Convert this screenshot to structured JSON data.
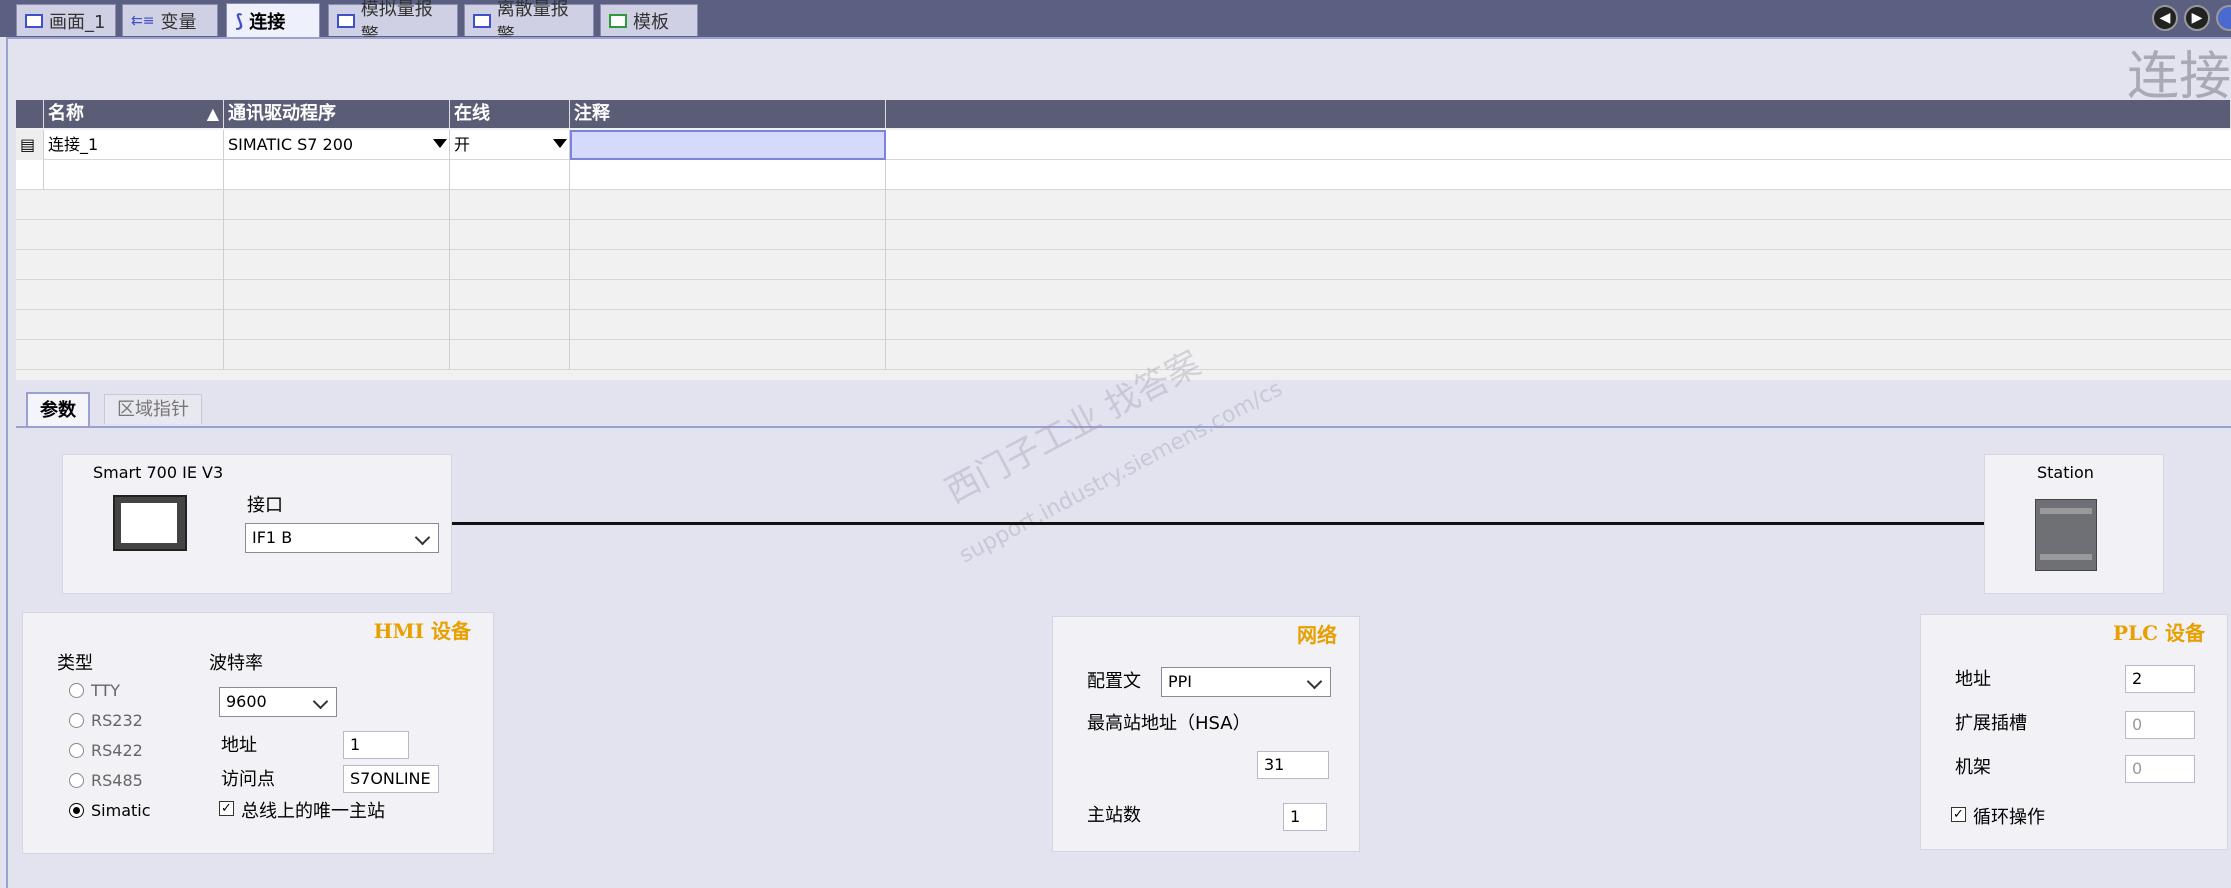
{
  "tabs": [
    {
      "label": "画面_1",
      "icon": "screen-icon"
    },
    {
      "label": "变量",
      "icon": "tags-icon"
    },
    {
      "label": "连接",
      "icon": "connection-icon",
      "active": true
    },
    {
      "label": "模拟量报警",
      "icon": "analog-alarm-icon"
    },
    {
      "label": "离散量报警",
      "icon": "discrete-alarm-icon"
    },
    {
      "label": "模板",
      "icon": "template-icon"
    }
  ],
  "editor_title": "连接",
  "table": {
    "headers": [
      "名称",
      "通讯驱动程序",
      "在线",
      "注释"
    ],
    "rows": [
      {
        "name": "连接_1",
        "driver": "SIMATIC S7 200",
        "online": "开",
        "comment": ""
      }
    ]
  },
  "subtabs": [
    "参数",
    "区域指针"
  ],
  "hmi_device": {
    "name": "Smart 700 IE V3",
    "interface_label": "接口",
    "interface_value": "IF1 B"
  },
  "station": {
    "name": "Station"
  },
  "hmi_panel": {
    "title": "HMI 设备",
    "type_label": "类型",
    "types": [
      "TTY",
      "RS232",
      "RS422",
      "RS485",
      "Simatic"
    ],
    "selected_type": "Simatic",
    "baud_label": "波特率",
    "baud_value": "9600",
    "address_label": "地址",
    "address_value": "1",
    "access_label": "访问点",
    "access_value": "S7ONLINE",
    "only_master_label": "总线上的唯一主站"
  },
  "network_panel": {
    "title": "网络",
    "profile_label": "配置文",
    "profile_value": "PPI",
    "hsa_label": "最高站地址（HSA）",
    "hsa_value": "31",
    "masters_label": "主站数",
    "masters_value": "1"
  },
  "plc_panel": {
    "title": "PLC 设备",
    "address_label": "地址",
    "address_value": "2",
    "slot_label": "扩展插槽",
    "slot_value": "0",
    "rack_label": "机架",
    "rack_value": "0",
    "cyclic_label": "循环操作"
  },
  "watermark": {
    "line1": "西门子工业  找答案",
    "line2": "support.industry.siemens.com/cs"
  }
}
